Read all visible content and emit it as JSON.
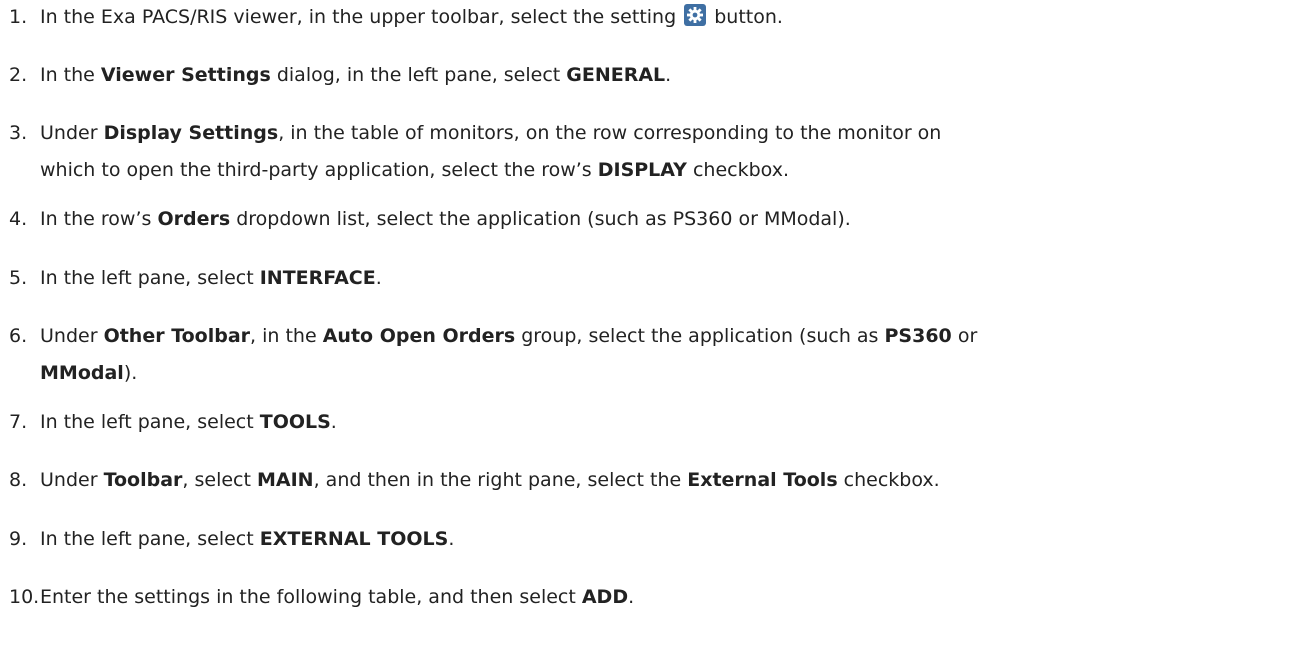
{
  "steps": [
    {
      "number": "1.",
      "lines": [
        [
          {
            "t": "In the Exa PACS/RIS viewer, in the upper toolbar, select the setting "
          },
          {
            "icon": "gear-icon"
          },
          {
            "t": " button."
          }
        ]
      ]
    },
    {
      "number": "2.",
      "lines": [
        [
          {
            "t": "In the "
          },
          {
            "t": "Viewer Settings",
            "b": true
          },
          {
            "t": " dialog, in the left pane, select "
          },
          {
            "t": "GENERAL",
            "b": true
          },
          {
            "t": "."
          }
        ]
      ]
    },
    {
      "number": "3.",
      "lines": [
        [
          {
            "t": "Under "
          },
          {
            "t": "Display Settings",
            "b": true
          },
          {
            "t": ", in the table of monitors, on the row corresponding to the monitor on"
          }
        ],
        [
          {
            "t": "which to open the third-party application, select the row’s "
          },
          {
            "t": "DISPLAY",
            "b": true
          },
          {
            "t": " checkbox."
          }
        ]
      ]
    },
    {
      "number": "4.",
      "lines": [
        [
          {
            "t": "In the row’s "
          },
          {
            "t": "Orders",
            "b": true
          },
          {
            "t": " dropdown list, select the application (such as PS360 or MModal)."
          }
        ]
      ]
    },
    {
      "number": "5.",
      "lines": [
        [
          {
            "t": "In the left pane, select "
          },
          {
            "t": "INTERFACE",
            "b": true
          },
          {
            "t": "."
          }
        ]
      ]
    },
    {
      "number": "6.",
      "lines": [
        [
          {
            "t": "Under "
          },
          {
            "t": "Other Toolbar",
            "b": true
          },
          {
            "t": ", in the "
          },
          {
            "t": "Auto Open Orders",
            "b": true
          },
          {
            "t": " group, select the application (such as "
          },
          {
            "t": "PS360",
            "b": true
          },
          {
            "t": " or"
          }
        ],
        [
          {
            "t": "MModal",
            "b": true
          },
          {
            "t": ")."
          }
        ]
      ]
    },
    {
      "number": "7.",
      "lines": [
        [
          {
            "t": "In the left pane, select "
          },
          {
            "t": "TOOLS",
            "b": true
          },
          {
            "t": "."
          }
        ]
      ]
    },
    {
      "number": "8.",
      "lines": [
        [
          {
            "t": "Under "
          },
          {
            "t": "Toolbar",
            "b": true
          },
          {
            "t": ", select "
          },
          {
            "t": "MAIN",
            "b": true
          },
          {
            "t": ", and then in the right pane, select the "
          },
          {
            "t": "External Tools",
            "b": true
          },
          {
            "t": " checkbox."
          }
        ]
      ]
    },
    {
      "number": "9.",
      "lines": [
        [
          {
            "t": "In the left pane, select "
          },
          {
            "t": "EXTERNAL TOOLS",
            "b": true
          },
          {
            "t": "."
          }
        ]
      ]
    },
    {
      "number": "10.",
      "lines": [
        [
          {
            "t": "Enter the settings in the following table, and then select "
          },
          {
            "t": "ADD",
            "b": true
          },
          {
            "t": "."
          }
        ]
      ]
    }
  ],
  "colors": {
    "text": "#222222",
    "gear_icon_bg": "#3f6fa3",
    "gear_icon_fg": "#ffffff"
  }
}
